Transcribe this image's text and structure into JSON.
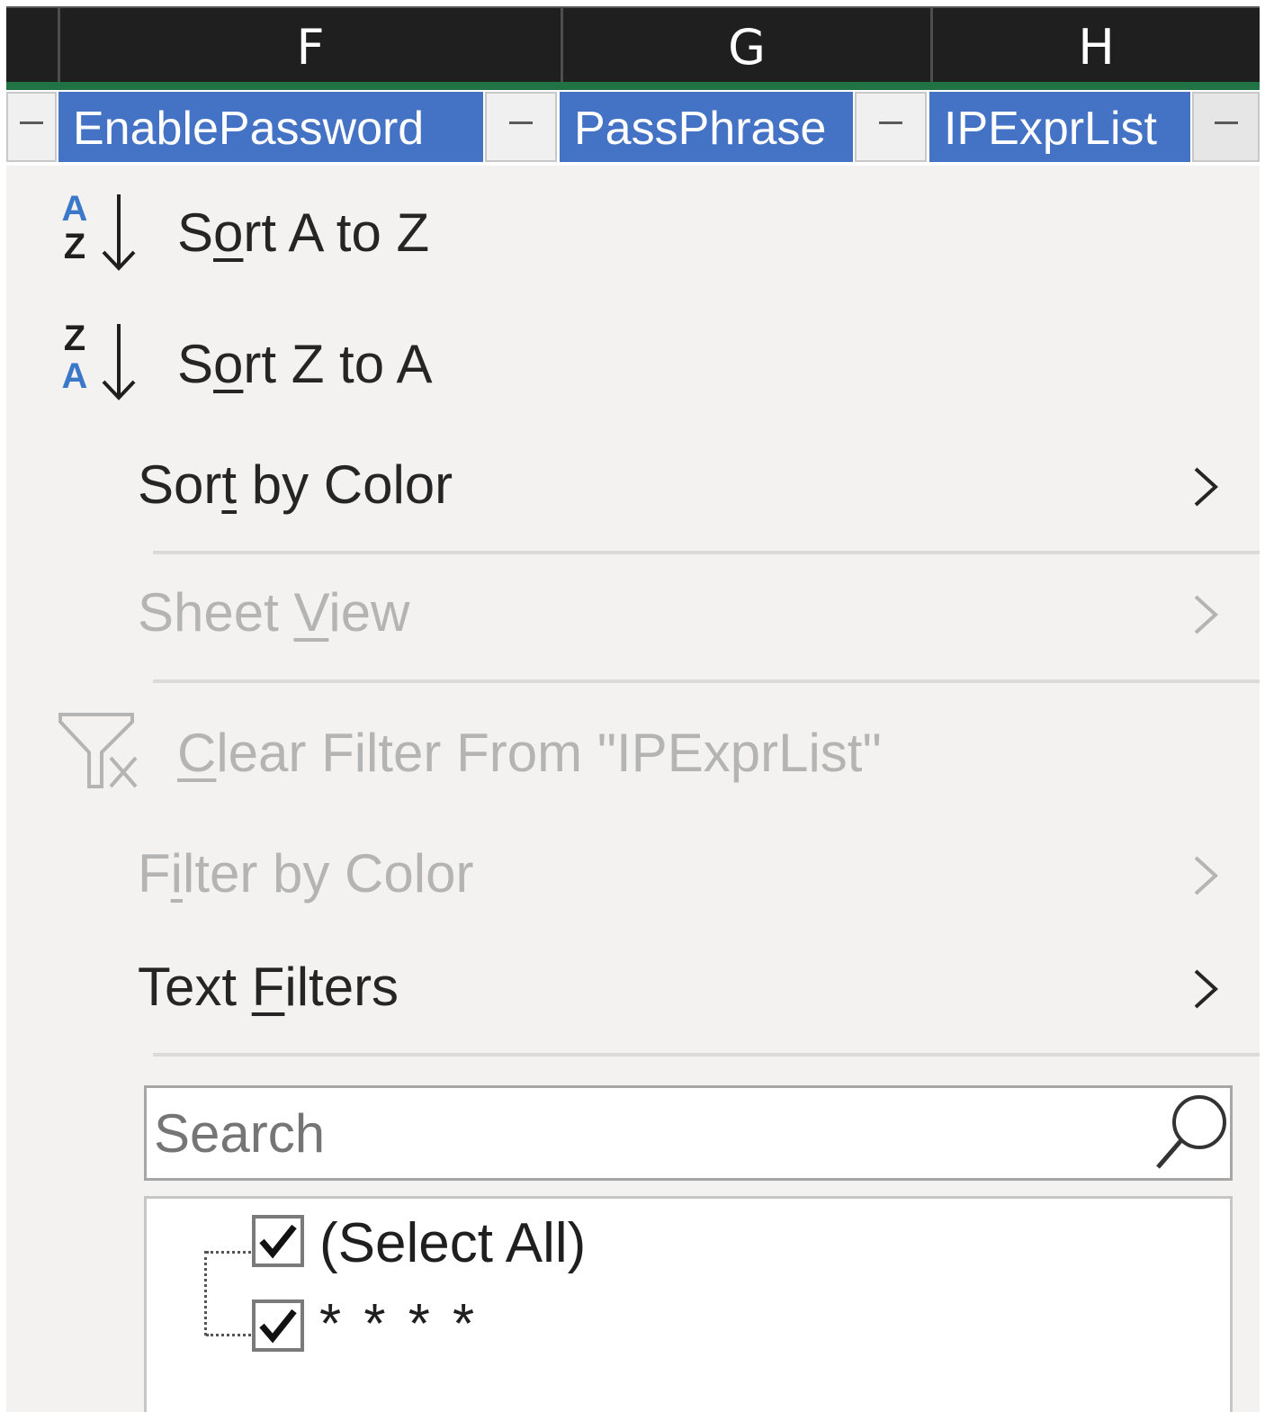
{
  "columns": {
    "letters": [
      "F",
      "G",
      "H"
    ]
  },
  "headers": [
    {
      "label": "EnablePassword"
    },
    {
      "label": "PassPhrase"
    },
    {
      "label": "IPExprList"
    }
  ],
  "menu": {
    "sort_az": {
      "pre": "S",
      "u": "o",
      "post": "rt A to Z",
      "icon_top": "A",
      "icon_bottom": "Z"
    },
    "sort_za": {
      "pre": "S",
      "u": "o",
      "post": "rt Z to A",
      "icon_top": "Z",
      "icon_bottom": "A"
    },
    "sort_by_color": {
      "pre": "Sor",
      "u": "t",
      "post": " by Color"
    },
    "sheet_view": {
      "pre": "Sheet ",
      "u": "V",
      "post": "iew"
    },
    "clear_filter": {
      "pre": "",
      "u": "C",
      "post": "lear Filter From \"IPExprList\""
    },
    "filter_by_color": {
      "pre": "F",
      "u": "i",
      "post": "lter by Color"
    },
    "text_filters": {
      "pre": "Text ",
      "u": "F",
      "post": "ilters"
    }
  },
  "search": {
    "placeholder": "Search"
  },
  "list": {
    "items": [
      {
        "label": "(Select All)",
        "checked": true
      },
      {
        "label": "* * * *",
        "checked": true
      }
    ]
  },
  "colors": {
    "header_blue": "#4472c4",
    "excel_green": "#217346",
    "icon_blue": "#3b78c9",
    "disabled_text": "#b4b4b4"
  }
}
